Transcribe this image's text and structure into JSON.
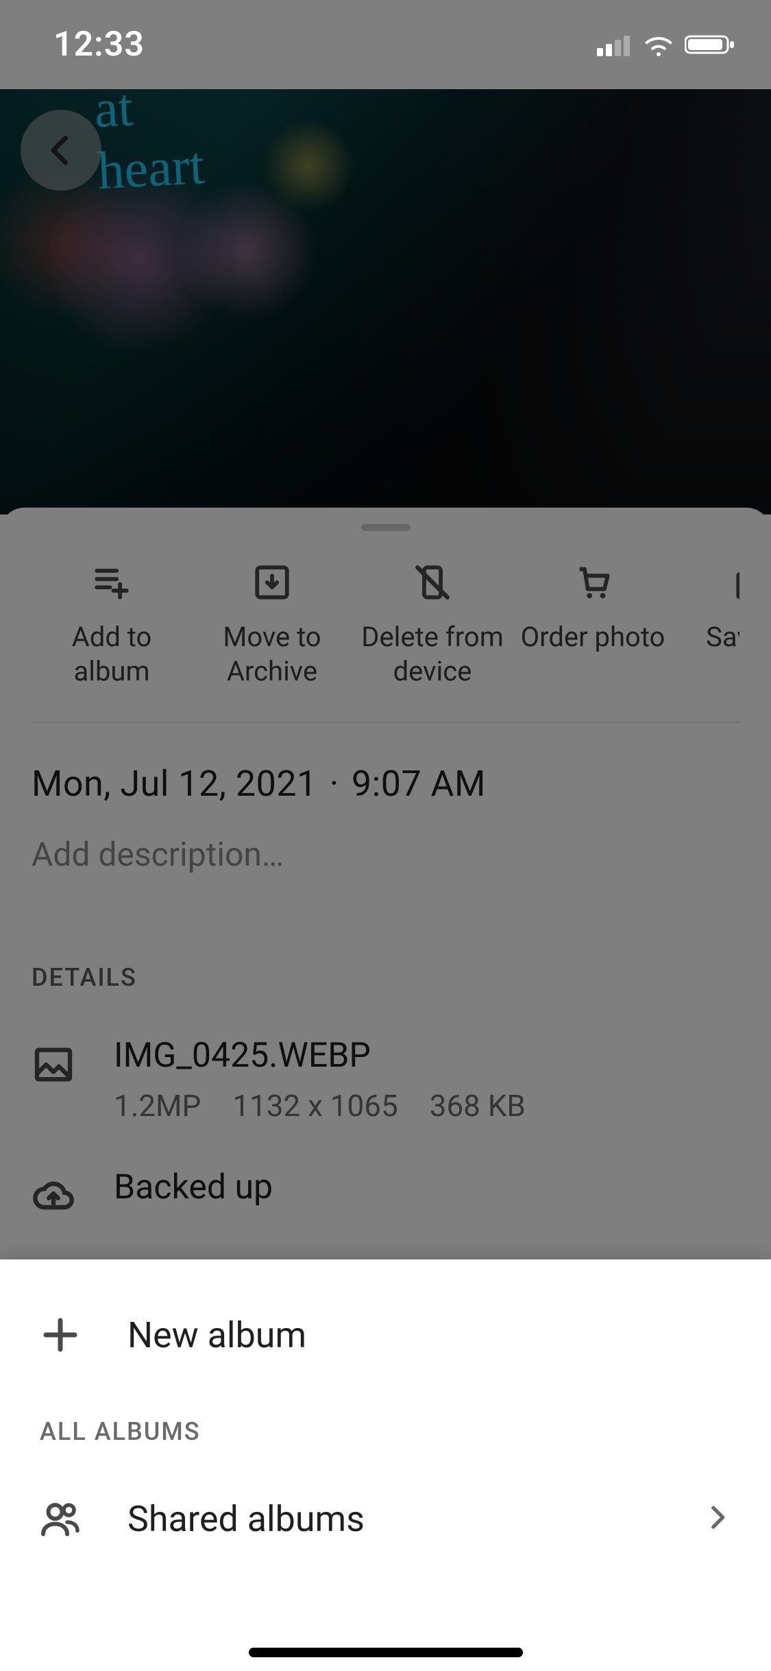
{
  "status": {
    "time": "12:33"
  },
  "actions": [
    {
      "id": "add-to-album",
      "label": "Add to\nalbum"
    },
    {
      "id": "move-to-archive",
      "label": "Move to\nArchive"
    },
    {
      "id": "delete-from-device",
      "label": "Delete from\ndevice"
    },
    {
      "id": "order-photo",
      "label": "Order photo"
    },
    {
      "id": "save-as",
      "label": "Save as"
    }
  ],
  "info": {
    "date": "Mon, Jul 12, 2021",
    "time": "9:07 AM",
    "description_placeholder": "Add description…",
    "details_heading": "DETAILS",
    "file": {
      "name": "IMG_0425.WEBP",
      "megapixels": "1.2MP",
      "dimensions": "1132 x 1065",
      "size": "368 KB"
    },
    "backup_status": "Backed up"
  },
  "album_sheet": {
    "new_album_label": "New album",
    "section_heading": "ALL ALBUMS",
    "shared_albums_label": "Shared albums"
  }
}
